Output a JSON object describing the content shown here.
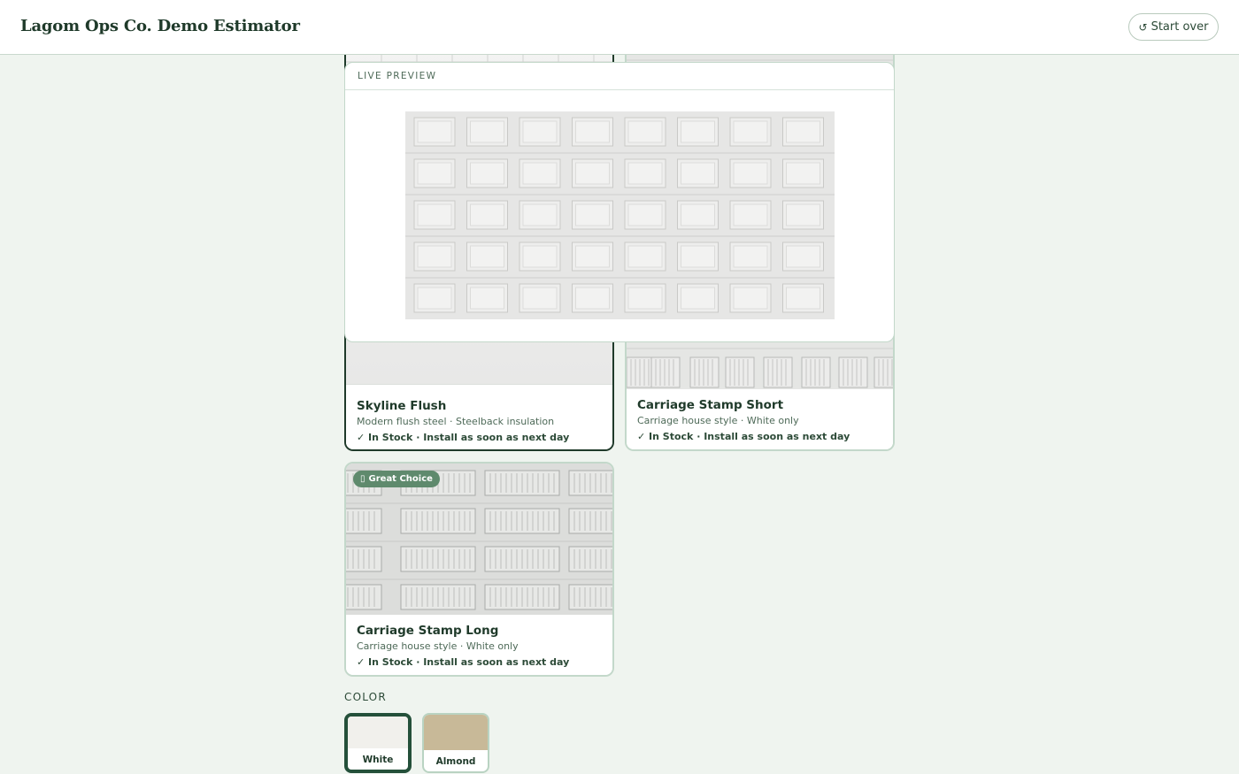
{
  "header": {
    "brand": "Lagom Ops Co. Demo Estimator",
    "start_over_icon": "↺",
    "start_over_label": "Start over"
  },
  "preview": {
    "title": "LIVE PREVIEW"
  },
  "cards": [
    {
      "title": "Skyline Flush",
      "subtitle": "Modern flush steel · Steelback insulation",
      "stock": "✓ In Stock · Install as soon as next day",
      "selected": true
    },
    {
      "title": "Carriage Stamp Short",
      "subtitle": "Carriage house style · White only",
      "stock": "✓ In Stock · Install as soon as next day",
      "selected": false
    },
    {
      "title": "Carriage Stamp Long",
      "subtitle": "Carriage house style · White only",
      "stock": "✓ In Stock · Install as soon as next day",
      "badge_icon": "▯",
      "badge": "Great Choice",
      "selected": false
    }
  ],
  "color": {
    "label": "COLOR",
    "options": [
      {
        "name": "White",
        "hex": "#f1f0ec",
        "selected": true
      },
      {
        "name": "Almond",
        "hex": "#c8b998",
        "selected": false
      }
    ]
  }
}
